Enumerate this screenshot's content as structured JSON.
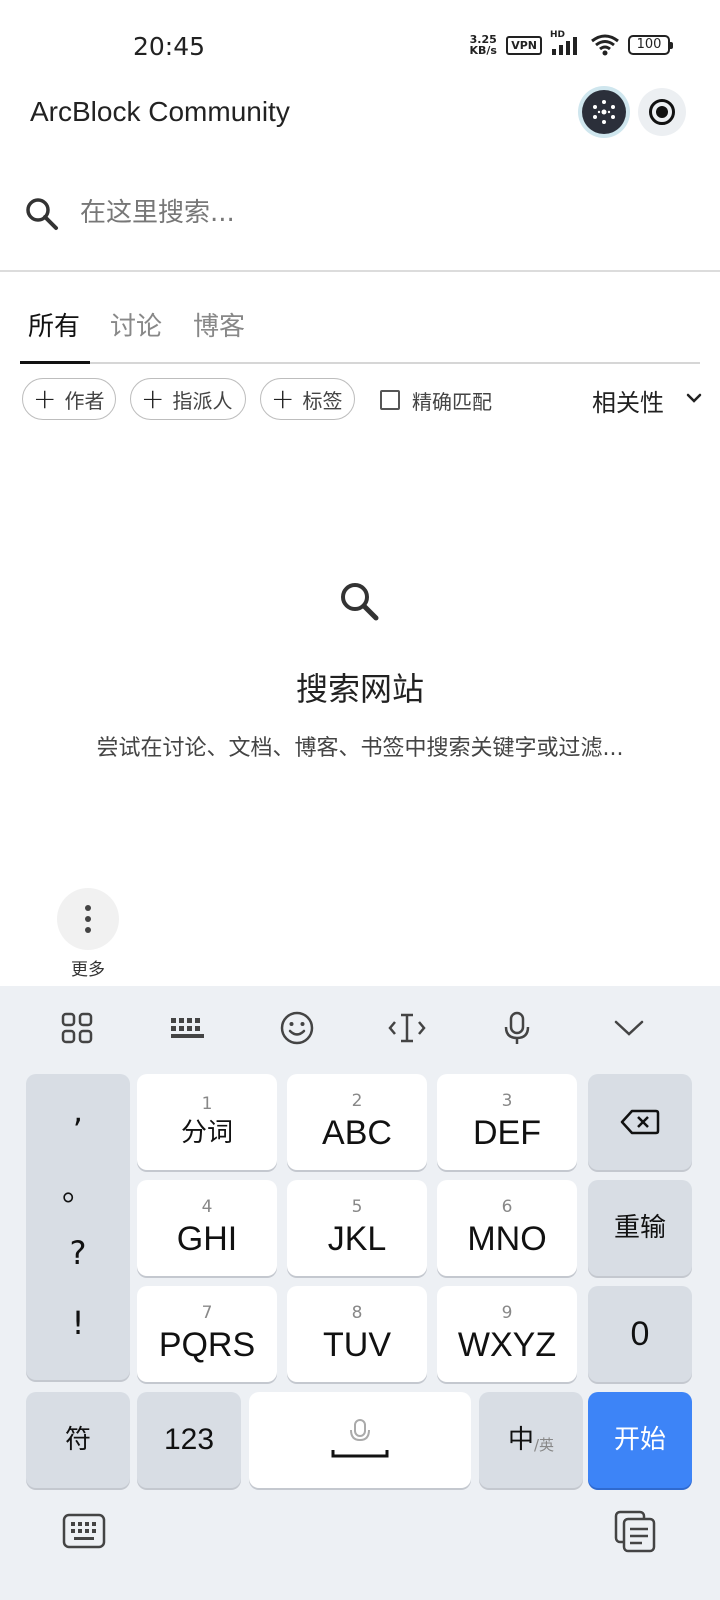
{
  "status_bar": {
    "time": "20:45",
    "net_speed_value": "3.25",
    "net_speed_unit": "KB/s",
    "vpn_label": "VPN",
    "signal_label": "HD",
    "battery": "100"
  },
  "app_bar": {
    "title": "ArcBlock Community"
  },
  "search": {
    "placeholder": "在这里搜索..."
  },
  "tabs": [
    {
      "label": "所有",
      "active": true
    },
    {
      "label": "讨论",
      "active": false
    },
    {
      "label": "博客",
      "active": false
    }
  ],
  "filters": {
    "chips": [
      {
        "label": "作者"
      },
      {
        "label": "指派人"
      },
      {
        "label": "标签"
      }
    ],
    "exact_match_label": "精确匹配",
    "exact_match_checked": false,
    "sort_label": "相关性"
  },
  "empty_state": {
    "title": "搜索网站",
    "description": "尝试在讨论、文档、博客、书签中搜索关键字或过滤..."
  },
  "more_button": {
    "label": "更多"
  },
  "keyboard": {
    "toolbar_icons": [
      "apps-grid-icon",
      "keyboard-layout-icon",
      "emoji-icon",
      "cursor-icon",
      "microphone-icon",
      "collapse-chevron-icon"
    ],
    "punctuation": [
      ",",
      "。",
      "?",
      "!"
    ],
    "keys": [
      {
        "num": "1",
        "label": "分词"
      },
      {
        "num": "2",
        "label": "ABC"
      },
      {
        "num": "3",
        "label": "DEF"
      },
      {
        "num": "4",
        "label": "GHI"
      },
      {
        "num": "5",
        "label": "JKL"
      },
      {
        "num": "6",
        "label": "MNO"
      },
      {
        "num": "7",
        "label": "PQRS"
      },
      {
        "num": "8",
        "label": "TUV"
      },
      {
        "num": "9",
        "label": "WXYZ"
      }
    ],
    "reinput_label": "重输",
    "zero_label": "0",
    "symbols_label": "符",
    "numbers_label": "123",
    "lang_main": "中",
    "lang_alt": "/英",
    "go_label": "开始",
    "accent_color": "#3d84f7"
  }
}
